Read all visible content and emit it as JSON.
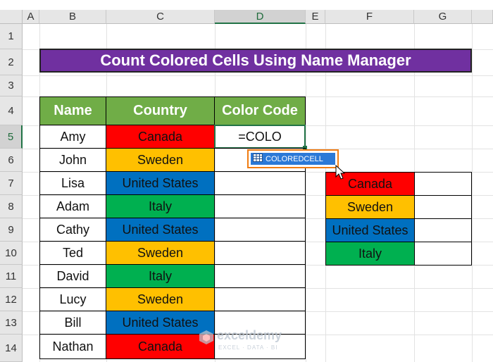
{
  "sheet": {
    "columns": [
      "A",
      "B",
      "C",
      "D",
      "E",
      "F",
      "G"
    ],
    "rows": [
      "1",
      "2",
      "3",
      "4",
      "5",
      "6",
      "7",
      "8",
      "9",
      "10",
      "11",
      "12",
      "13",
      "14"
    ],
    "active_column": "D",
    "active_row": "5"
  },
  "title": "Count Colored Cells Using Name Manager",
  "table": {
    "headers": [
      "Name",
      "Country",
      "Color Code"
    ],
    "rows": [
      {
        "name": "Amy",
        "country": "Canada",
        "color": "red"
      },
      {
        "name": "John",
        "country": "Sweden",
        "color": "yellow"
      },
      {
        "name": "Lisa",
        "country": "United States",
        "color": "blue"
      },
      {
        "name": "Adam",
        "country": "Italy",
        "color": "green"
      },
      {
        "name": "Cathy",
        "country": "United States",
        "color": "blue"
      },
      {
        "name": "Ted",
        "country": "Sweden",
        "color": "yellow"
      },
      {
        "name": "David",
        "country": "Italy",
        "color": "green"
      },
      {
        "name": "Lucy",
        "country": "Sweden",
        "color": "yellow"
      },
      {
        "name": "Bill",
        "country": "United States",
        "color": "blue"
      },
      {
        "name": "Nathan",
        "country": "Canada",
        "color": "red"
      }
    ]
  },
  "formula_input": "=COLO",
  "autocomplete": {
    "suggestion": "COLOREDCELL",
    "icon": "function-icon"
  },
  "legend": [
    {
      "country": "Canada",
      "color": "red"
    },
    {
      "country": "Sweden",
      "color": "yellow"
    },
    {
      "country": "United States",
      "color": "blue"
    },
    {
      "country": "Italy",
      "color": "green"
    }
  ],
  "colors": {
    "title_bg": "#7030a0",
    "header_bg": "#70ad47",
    "red": "#ff0000",
    "yellow": "#ffc000",
    "blue": "#0070c0",
    "green": "#00b050",
    "selection": "#217346",
    "suggest_border": "#f07c12"
  },
  "watermark": {
    "brand": "exceldemy",
    "tagline": "EXCEL · DATA · BI"
  }
}
